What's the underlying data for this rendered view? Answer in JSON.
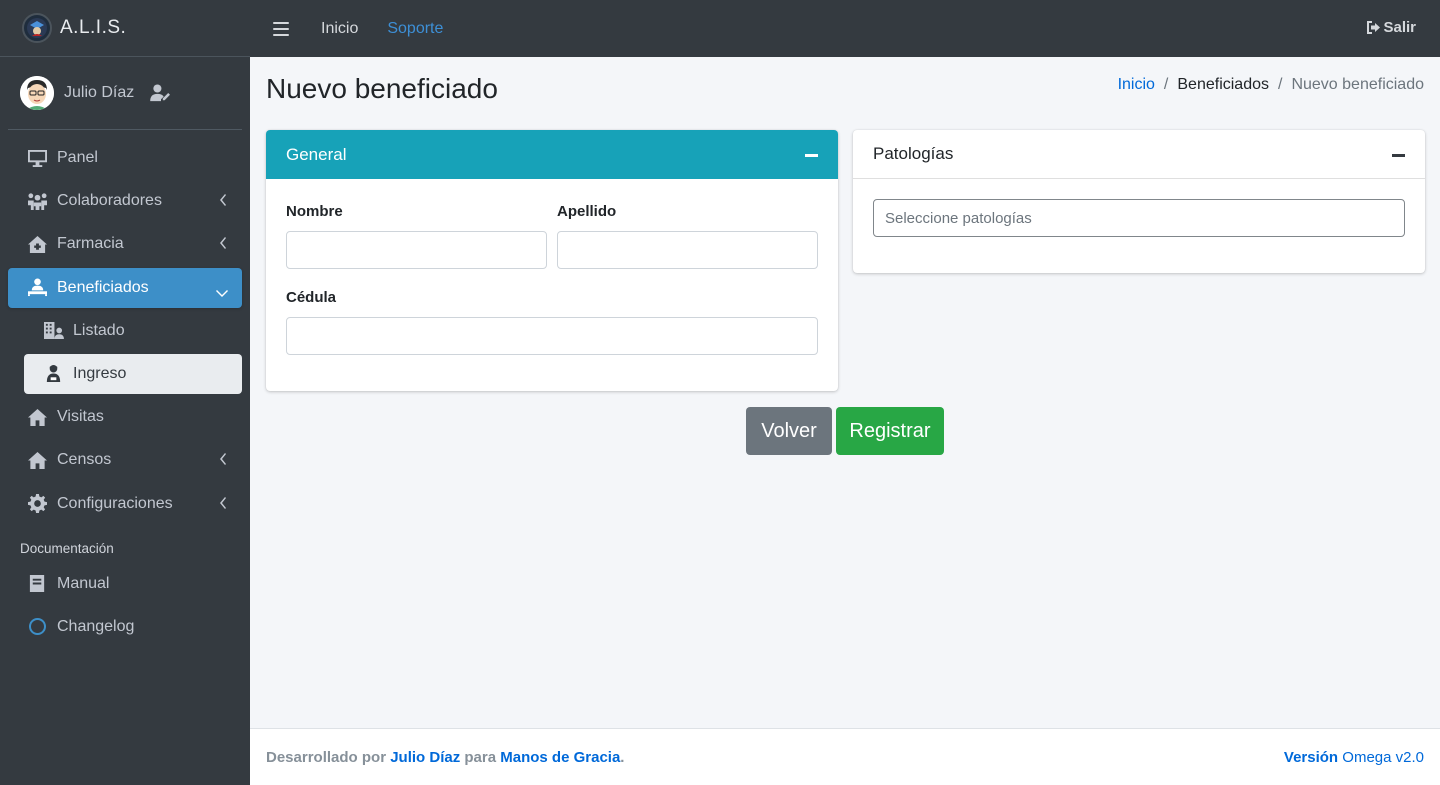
{
  "brand": {
    "name": "A.L.I.S."
  },
  "user": {
    "name": "Julio Díaz"
  },
  "topbar": {
    "links": [
      "Inicio",
      "Soporte"
    ],
    "logout": "Salir"
  },
  "sidebar": {
    "items": [
      {
        "label": "Panel",
        "icon": "desktop-icon"
      },
      {
        "label": "Colaboradores",
        "icon": "people-icon"
      },
      {
        "label": "Farmacia",
        "icon": "clinic-icon"
      },
      {
        "label": "Beneficiados",
        "icon": "person-bed-icon"
      },
      {
        "label": "Listado",
        "icon": "building-user-icon"
      },
      {
        "label": "Ingreso",
        "icon": "user-injured-icon"
      },
      {
        "label": "Visitas",
        "icon": "home-icon"
      },
      {
        "label": "Censos",
        "icon": "home-icon"
      },
      {
        "label": "Configuraciones",
        "icon": "gear-icon"
      },
      {
        "label": "Manual",
        "icon": "book-icon"
      },
      {
        "label": "Changelog",
        "icon": "circle-icon"
      }
    ],
    "section_header": "Documentación"
  },
  "page": {
    "title": "Nuevo beneficiado",
    "breadcrumb": [
      "Inicio",
      "Beneficiados",
      "Nuevo beneficiado"
    ],
    "separator": "/"
  },
  "general_card": {
    "title": "General",
    "fields": {
      "nombre": "Nombre",
      "apellido": "Apellido",
      "cedula": "Cédula"
    }
  },
  "patologias_card": {
    "title": "Patologías",
    "placeholder": "Seleccione patologías"
  },
  "buttons": {
    "back": "Volver",
    "register": "Registrar"
  },
  "footer": {
    "prefix": "Desarrollado por",
    "author": "Julio Díaz",
    "middle": "para",
    "org": "Manos de Gracia",
    "end": ".",
    "version_label": "Versión",
    "version_value": "Omega v2.0"
  },
  "colors": {
    "sidebar": "#343a40",
    "active": "#3d8fc8",
    "card_header": "#17a2b8",
    "success": "#28a745",
    "secondary": "#6c757d",
    "link": "#0069d9"
  }
}
